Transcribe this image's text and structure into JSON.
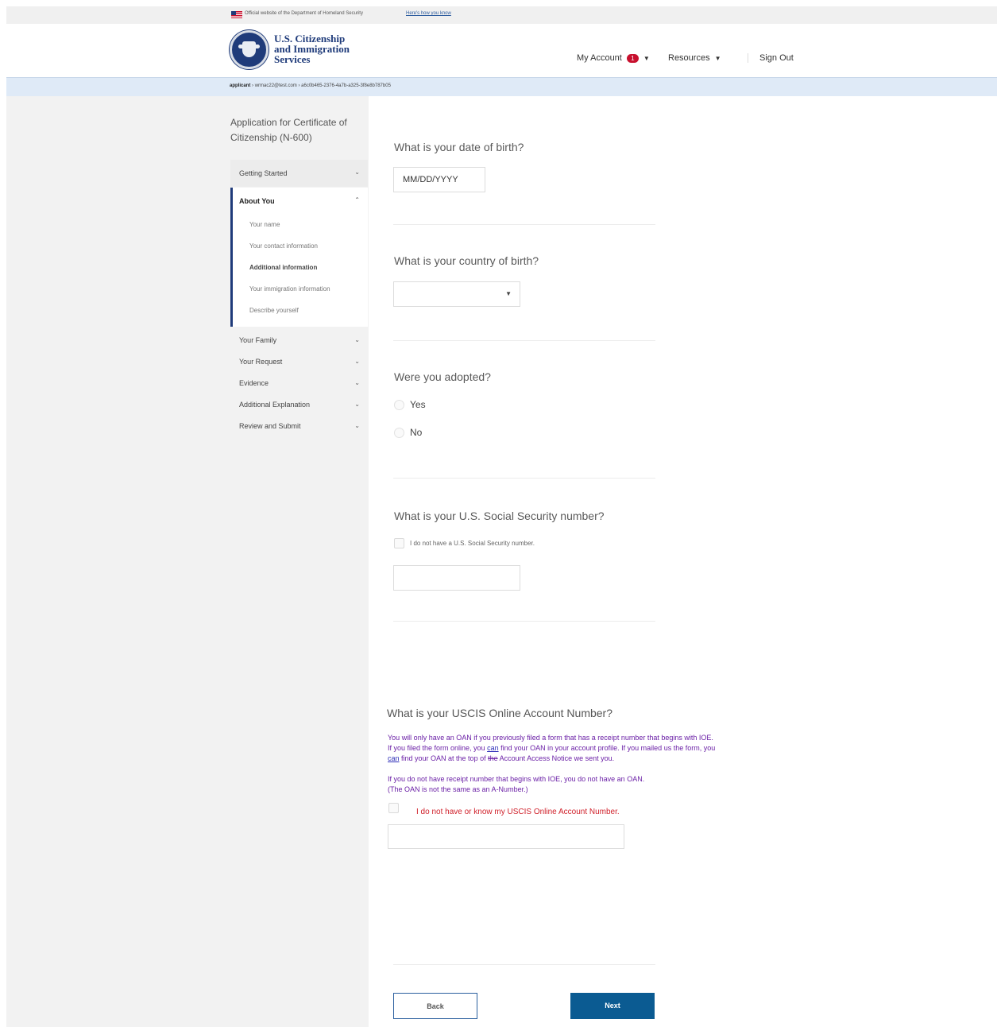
{
  "gov_banner": {
    "official_text": "Official website of the Department of Homeland Security",
    "how_know": "Here's how you know"
  },
  "header": {
    "agency_lines": [
      "U.S. Citizenship",
      "and Immigration",
      "Services"
    ],
    "my_account": "My Account",
    "notification_count": "1",
    "resources": "Resources",
    "sign_out": "Sign Out"
  },
  "breadcrumb": {
    "role": "applicant",
    "email": "wrmac22@test.com",
    "case_id": "a6c0b465-2376-4a7b-a325-3f8e8b787b05"
  },
  "sidebar": {
    "app_title": "Application for Certificate of Citizenship (N-600)",
    "sections": {
      "getting_started": "Getting Started",
      "about_you": "About You",
      "your_family": "Your Family",
      "your_request": "Your Request",
      "evidence": "Evidence",
      "additional_explanation": "Additional Explanation",
      "review_submit": "Review and Submit"
    },
    "about_you_items": {
      "your_name": "Your name",
      "contact_info": "Your contact information",
      "additional_info": "Additional information",
      "immigration_info": "Your immigration information",
      "describe_yourself": "Describe yourself"
    }
  },
  "form": {
    "dob_question": "What is your date of birth?",
    "dob_placeholder": "MM/DD/YYYY",
    "country_question": "What is your country of birth?",
    "country_value": "",
    "adopted_question": "Were you adopted?",
    "adopted_options": [
      "Yes",
      "No"
    ],
    "ssn_question": "What is your U.S. Social Security number?",
    "ssn_checkbox_label": "I do not have a U.S. Social Security number.",
    "ssn_value": "",
    "oan_question": "What is your USCIS Online Account Number?",
    "oan_help": {
      "line1": "You will only have an OAN if you previously filed a form that has a receipt number that begins with IOE.",
      "line2_a": "If you filed the form online, you ",
      "line2_can": "can",
      "line2_b": " find your OAN in your account profile. If you mailed us the form, you",
      "line3_can": "can",
      "line3_a": " find your OAN at the top of ",
      "line3_strike": "the",
      "line3_b": " Account Access Notice we sent you.",
      "line4": "If you do not have receipt number that begins with IOE, you do not have an OAN.",
      "line5": "(The OAN is not the same as an A-Number.)"
    },
    "oan_checkbox_label": "I do not have or know my USCIS Online Account Number.",
    "oan_value": ""
  },
  "buttons": {
    "back": "Back",
    "next": "Next"
  }
}
